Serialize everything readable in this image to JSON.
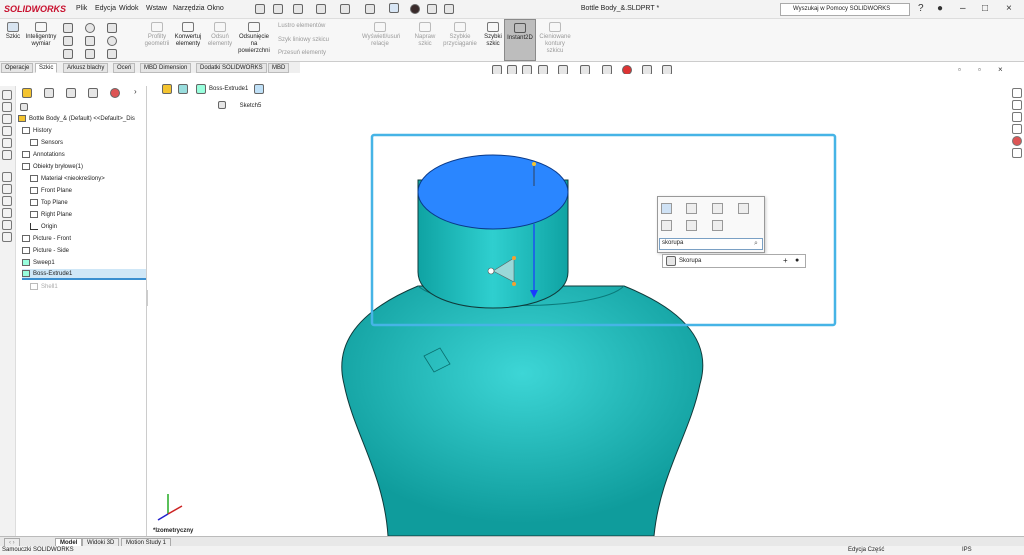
{
  "app": {
    "logo": "SOLIDWORKS",
    "title": "Bottle Body_&.SLDPRT *"
  },
  "menu": [
    "Plik",
    "Edycja",
    "Widok",
    "Wstaw",
    "Narzędzia",
    "Okno"
  ],
  "search": {
    "placeholder": "Wyszukaj w Pomocy SOLIDWORKS"
  },
  "ribbon": {
    "sketch": "Szkic",
    "smart_dim": "Inteligentny wymiar",
    "profile_geometry": "Profilty geometrii",
    "convert": "Konwertuj elementy",
    "offset": "Odsuń elementy",
    "offset_surface": "Odsunięcie na powierzchni",
    "mirror": "Lustro elementów",
    "linear_pattern": "Szyk liniowy szkicu",
    "move": "Przesuń elementy",
    "relations": "Wyświetl/usuń relacje",
    "repair": "Napraw szkic",
    "quick_snaps": "Szybkie przyciąganie",
    "rapid_sketch": "Szybki szkic",
    "instant2d": "Instant2D",
    "shaded_contours": "Cieniowane kontury szkicu"
  },
  "cm_tabs": [
    "Operacje",
    "Szkic",
    "Arkusz blachy",
    "Oceń",
    "MBD Dimension",
    "Dodatki SOLIDWORKS",
    "MBD"
  ],
  "tree": {
    "root": "Bottle Body_& (Default) <<Default>_Dis",
    "items": [
      "History",
      "Sensors",
      "Annotations",
      "Obiekty bryłowe(1)",
      "Materiał <nieokreślony>",
      "Front Plane",
      "Top Plane",
      "Right Plane",
      "Origin",
      "Picture - Front",
      "Picture - Side",
      "Sweep1",
      "Boss-Extrude1",
      "Shell1"
    ]
  },
  "breadcrumb": {
    "feature": "Boss-Extrude1",
    "sketch": "Sketch5"
  },
  "shortcut": {
    "query": "skorupa",
    "result": "Skorupa"
  },
  "view": {
    "orientation": "*Izometryczny"
  },
  "bottom_tabs": [
    "Model",
    "Widoki 3D",
    "Motion Study 1"
  ],
  "status": {
    "left": "Samouczki SOLIDWORKS",
    "mode": "Edycja Część",
    "units": "IPS"
  },
  "colors": {
    "body": "#17b8b8",
    "top_face": "#2a86ff",
    "selection": "#46b4e6",
    "accent": "#c8102e"
  }
}
